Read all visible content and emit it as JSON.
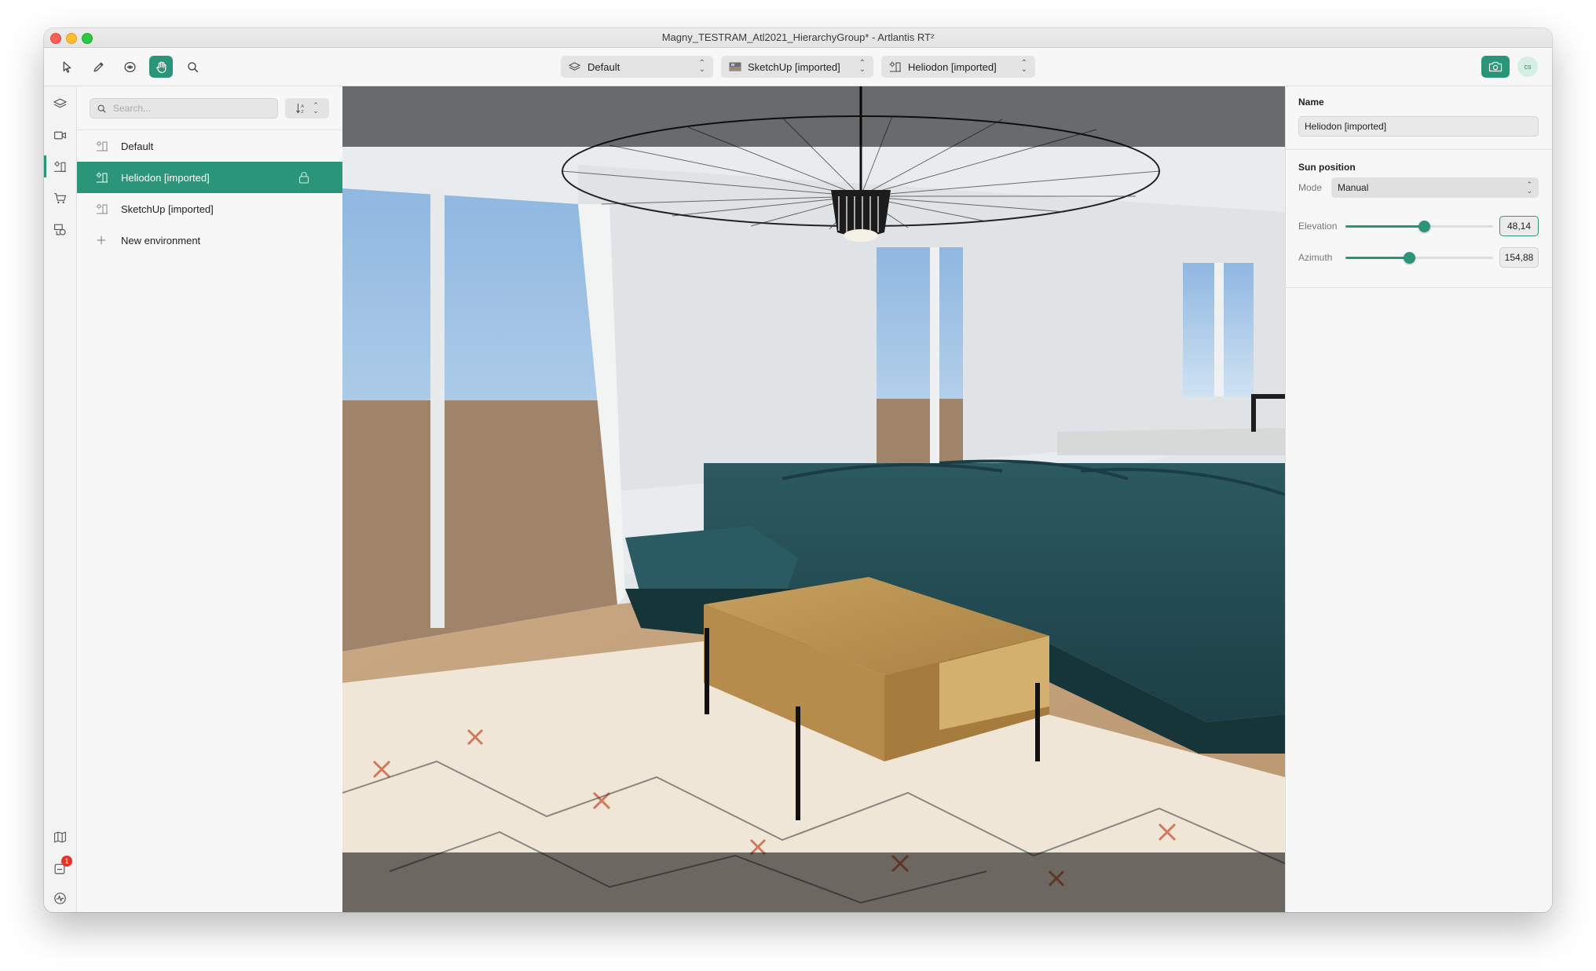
{
  "window": {
    "title": "Magny_TESTRAM_Atl2021_HierarchyGroup* - Artlantis RT²"
  },
  "toolbar": {
    "tools": [
      {
        "name": "select-tool",
        "icon": "arrow-pointer-icon"
      },
      {
        "name": "pen-tool",
        "icon": "pencil-icon"
      },
      {
        "name": "orbit-tool",
        "icon": "orbit-icon"
      },
      {
        "name": "pan-tool",
        "icon": "hand-icon",
        "active": true
      },
      {
        "name": "zoom-tool",
        "icon": "magnifier-icon"
      }
    ],
    "layer_dropdown": {
      "value": "Default",
      "icon": "layers-icon"
    },
    "camera_dropdown": {
      "value": "SketchUp [imported]",
      "icon": "camera-thumbnail-icon"
    },
    "environment_dropdown": {
      "value": "Heliodon [imported]",
      "icon": "heliodon-icon"
    },
    "render_button_icon": "camera-icon",
    "user_initials": "cs"
  },
  "rail": {
    "items": [
      "layers-icon",
      "video-camera-icon",
      "heliodon-icon",
      "cart-icon",
      "objects-icon"
    ],
    "bottom_items": [
      "map-icon",
      "notifications-icon",
      "activity-icon"
    ],
    "notification_count": "1",
    "accent": "#2a9579"
  },
  "list": {
    "search_placeholder": "Search...",
    "sort_icon": "sort-icon",
    "items": [
      {
        "label": "Default",
        "selected": false
      },
      {
        "label": "Heliodon [imported]",
        "selected": true,
        "locked": true
      },
      {
        "label": "SketchUp [imported]",
        "selected": false
      }
    ],
    "add_label": "New environment"
  },
  "props": {
    "name_title": "Name",
    "name_value": "Heliodon [imported]",
    "sun_title": "Sun position",
    "mode_label": "Mode",
    "mode_value": "Manual",
    "elevation": {
      "label": "Elevation",
      "value": "48,14",
      "fraction": 0.53
    },
    "azimuth": {
      "label": "Azimuth",
      "value": "154,88",
      "fraction": 0.43
    }
  }
}
